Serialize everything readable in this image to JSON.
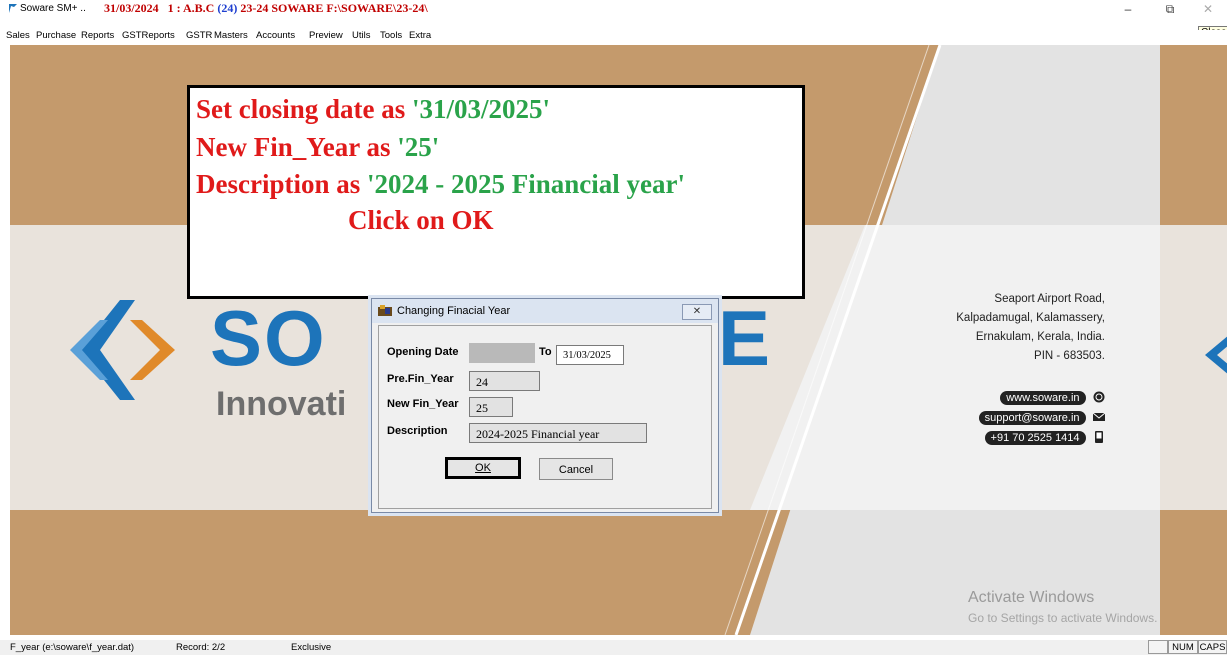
{
  "title_bar": {
    "app_name": "Soware SM+ ..",
    "date": "31/03/2024",
    "company_prefix": "1 : A.B.C",
    "company_code": "(24)",
    "period_path": "23-24 SOWARE F:\\SOWARE\\23-24\\",
    "minimize_symbol": "–",
    "restore_symbol": "⧉",
    "close_symbol": "✕",
    "close_tooltip": "Close"
  },
  "menu": [
    "Sales",
    "Purchase",
    "Reports",
    "GSTReports",
    "GSTR",
    "Masters",
    "Accounts",
    "Preview",
    "Utils",
    "Tools",
    "Extra"
  ],
  "instruction": {
    "line1_a": "Set closing date as ",
    "line1_b": "'31/03/2025'",
    "line2_a": "New Fin_Year as ",
    "line2_b": "'25'",
    "line3_a": "Description as ",
    "line3_b": "'2024 - 2025 Financial year'",
    "line4": "Click on OK"
  },
  "background": {
    "logo_text": "SO",
    "logo_text_end": "E",
    "logo_subtext": "Innovati",
    "address": [
      "Seaport Airport Road,",
      "Kalpadamugal, Kalamassery,",
      "Ernakulam, Kerala, India.",
      "PIN - 683503."
    ],
    "website": "www.soware.in",
    "email": "support@soware.in",
    "phone": "+91 70 2525 1414",
    "activate_title": "Activate Windows",
    "activate_sub": "Go to Settings to activate Windows."
  },
  "dialog": {
    "title": "Changing Finacial Year",
    "close_symbol": "✕",
    "opening_date_label": "Opening Date",
    "opening_date_value": "",
    "to_label": "To",
    "to_value": "31/03/2025",
    "pre_fin_year_label": "Pre.Fin_Year",
    "pre_fin_year_value": "24",
    "new_fin_year_label": "New Fin_Year",
    "new_fin_year_value": "25",
    "description_label": "Description",
    "description_value": "2024-2025 Financial year",
    "ok_label": "OK",
    "cancel_label": "Cancel"
  },
  "status_bar": {
    "file": "F_year (e:\\soware\\f_year.dat)",
    "record": "Record: 2/2",
    "mode": "Exclusive",
    "num": "NUM",
    "caps": "CAPS"
  },
  "colors": {
    "brand_blue": "#1d74ba",
    "instruction_red": "#e01a1a",
    "instruction_green": "#2aa34a",
    "title_red": "#c00000",
    "background_tan": "#c49a6c"
  }
}
